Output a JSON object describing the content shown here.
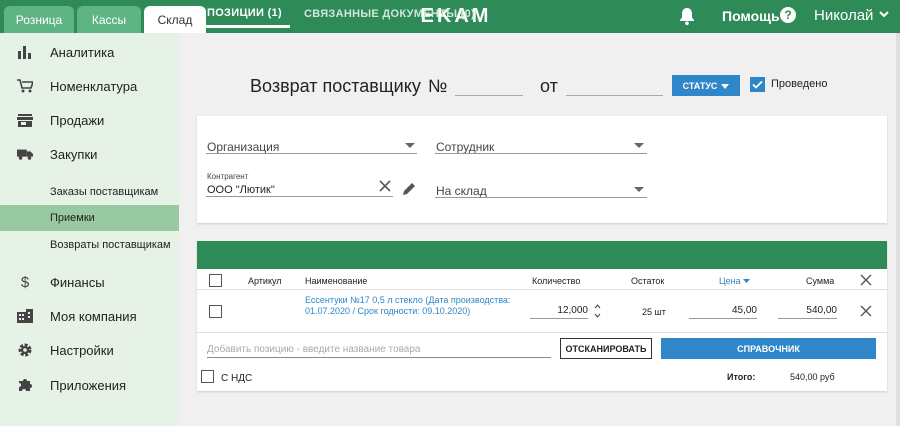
{
  "tabs": [
    {
      "label": "Розница"
    },
    {
      "label": "Кассы"
    },
    {
      "label": "Склад"
    }
  ],
  "logo": "EKAM",
  "header": {
    "help": "Помощь",
    "help_icon": "?",
    "user": "Николай"
  },
  "sidebar": {
    "items": [
      {
        "label": "Аналитика",
        "icon": "chart-icon"
      },
      {
        "label": "Номенклатура",
        "icon": "cart-icon"
      },
      {
        "label": "Продажи",
        "icon": "store-icon"
      },
      {
        "label": "Закупки",
        "icon": "truck-icon"
      }
    ],
    "subitems": [
      {
        "label": "Заказы поставщикам"
      },
      {
        "label": "Приемки",
        "active": true
      },
      {
        "label": "Возвраты поставщикам"
      }
    ],
    "items2": [
      {
        "label": "Финансы",
        "icon": "dollar-icon"
      },
      {
        "label": "Моя компания",
        "icon": "building-icon"
      },
      {
        "label": "Настройки",
        "icon": "gear-icon"
      },
      {
        "label": "Приложения",
        "icon": "puzzle-icon"
      }
    ]
  },
  "doc": {
    "title": "Возврат поставщику",
    "number_sign": "№",
    "number": "",
    "from_label": "от",
    "date": "",
    "status_label": "СТАТУС",
    "posted_label": "Проведено",
    "posted": true
  },
  "form": {
    "organization": "Организация",
    "employee": "Сотрудник",
    "counterparty_label": "Контрагент",
    "counterparty_value": "ООО \"Лютик\"",
    "warehouse": "На склад"
  },
  "positions": {
    "tab_active": "ПОЗИЦИИ (1)",
    "tab_related": "СВЯЗАННЫЕ ДОКУМЕНТЫ (0)",
    "columns": {
      "article": "Артикул",
      "name": "Наименование",
      "quantity": "Количество",
      "rest": "Остаток",
      "price": "Цена",
      "sum": "Сумма"
    },
    "row": {
      "article": "",
      "name": "Ессентуки №17 0,5 л стекло (Дата производства: 01.07.2020 / Срок годности: 09.10.2020)",
      "quantity": "12,000",
      "rest": "25 шт",
      "price": "45,00",
      "sum": "540,00"
    },
    "add_placeholder": "Добавить позицию - введите название товара",
    "scan_label": "ОТСКАНИРОВАТЬ",
    "catalog_label": "СПРАВОЧНИК",
    "vat_label": "С НДС",
    "total_label": "Итого:",
    "total_value": "540,00 руб"
  },
  "colors": {
    "brand": "#2e8b57",
    "accent": "#2f86c8",
    "sidebar": "#e7f2e7",
    "sidebar_active": "#98c9a2"
  }
}
